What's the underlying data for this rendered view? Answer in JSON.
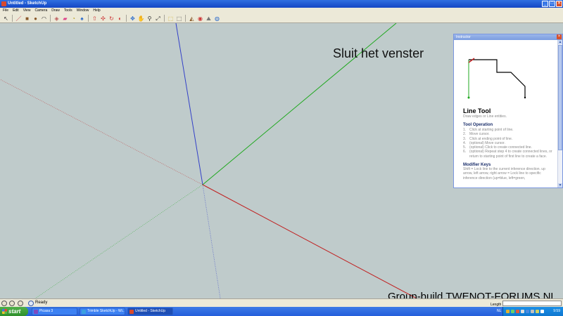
{
  "window": {
    "title": "Untitled - SketchUp",
    "buttons": {
      "minimize": "_",
      "maximize": "□",
      "close": "✕"
    }
  },
  "menu": [
    "File",
    "Edit",
    "View",
    "Camera",
    "Draw",
    "Tools",
    "Window",
    "Help"
  ],
  "toolbar": {
    "tools": [
      {
        "name": "select-tool-icon",
        "glyph": "↖"
      },
      {
        "name": "line-tool-icon",
        "glyph": "／"
      },
      {
        "name": "rectangle-tool-icon",
        "glyph": "■"
      },
      {
        "name": "circle-tool-icon",
        "glyph": "●"
      },
      {
        "name": "arc-tool-icon",
        "glyph": "◠"
      },
      {
        "name": "make-component-icon",
        "glyph": "◈"
      },
      {
        "name": "eraser-tool-icon",
        "glyph": "▰"
      },
      {
        "name": "tape-measure-icon",
        "glyph": "◔"
      },
      {
        "name": "paint-bucket-icon",
        "glyph": "♠"
      },
      {
        "name": "push-pull-icon",
        "glyph": "⇧"
      },
      {
        "name": "move-tool-icon",
        "glyph": "✣"
      },
      {
        "name": "rotate-tool-icon",
        "glyph": "↻"
      },
      {
        "name": "offset-tool-icon",
        "glyph": "◐"
      },
      {
        "name": "orbit-tool-icon",
        "glyph": "✥"
      },
      {
        "name": "pan-tool-icon",
        "glyph": "✋"
      },
      {
        "name": "zoom-tool-icon",
        "glyph": "⚲"
      },
      {
        "name": "zoom-extents-icon",
        "glyph": "⤢"
      },
      {
        "name": "get-models-icon",
        "glyph": "⬚"
      },
      {
        "name": "share-model-icon",
        "glyph": "⬚"
      },
      {
        "name": "get-photo-texture-icon",
        "glyph": "◭"
      },
      {
        "name": "add-location-icon",
        "glyph": "◉"
      },
      {
        "name": "toggle-terrain-icon",
        "glyph": "⛰"
      },
      {
        "name": "preview-google-earth-icon",
        "glyph": "◍"
      }
    ]
  },
  "annotation": "Sluit het venster",
  "watermark": "Group-build TWENOT-FORUMS.NL",
  "axis_colors": {
    "blue": "#3340c8",
    "green": "#1fa81f",
    "red": "#c02020"
  },
  "instructor": {
    "title": "Instructor",
    "heading": "Line Tool",
    "subtitle": "Draw edges or Line entities.",
    "operation_title": "Tool Operation",
    "steps": [
      "Click at starting point of line.",
      "Move cursor.",
      "Click at ending point of line.",
      "(optional) Move cursor.",
      "(optional) Click to create connected line.",
      "(optional) Repeat step 4 to create connected lines, or return to starting point of first line to create a face."
    ],
    "modifier_title": "Modifier Keys",
    "modifier_text": "Shift = Lock line to the current inference direction. up arrow, left arrow, right arrow = Lock line to specific inference direction (up=blue, left=green,"
  },
  "statusbar": {
    "status": "Ready",
    "length_label": "Length",
    "length_value": ""
  },
  "taskbar": {
    "start": "start",
    "tasks": [
      {
        "label": "Picasa 3",
        "color": "#7d4bc0"
      },
      {
        "label": "Trimble SketchUp - Wi...",
        "color": "#3aa0e0"
      },
      {
        "label": "Untitled - SketchUp",
        "color": "#d84a2e"
      }
    ],
    "language": "NL",
    "clock": "9:59"
  }
}
